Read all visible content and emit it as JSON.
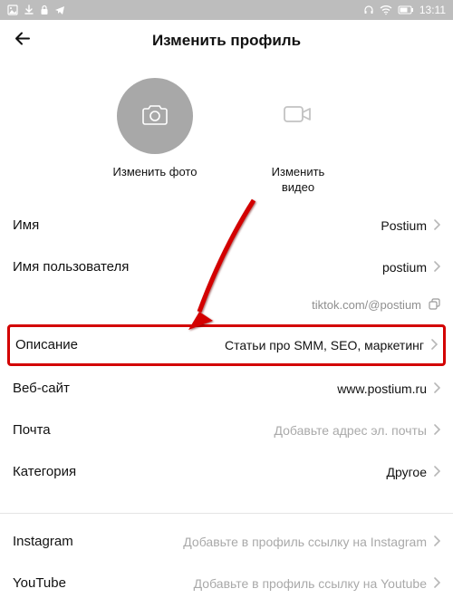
{
  "statusbar": {
    "time": "13:11"
  },
  "header": {
    "title": "Изменить профиль"
  },
  "media": {
    "photo_label": "Изменить фото",
    "video_label": "Изменить\nвидео"
  },
  "rows": {
    "name": {
      "label": "Имя",
      "value": "Postium"
    },
    "username": {
      "label": "Имя пользователя",
      "value": "postium"
    },
    "url": {
      "value": "tiktok.com/@postium"
    },
    "bio": {
      "label": "Описание",
      "value": "Статьи про SMM, SEO, маркетинг"
    },
    "website": {
      "label": "Веб-сайт",
      "value": "www.postium.ru"
    },
    "email": {
      "label": "Почта",
      "placeholder": "Добавьте адрес эл. почты"
    },
    "category": {
      "label": "Категория",
      "value": "Другое"
    },
    "instagram": {
      "label": "Instagram",
      "placeholder": "Добавьте в профиль ссылку на Instagram"
    },
    "youtube": {
      "label": "YouTube",
      "placeholder": "Добавьте в профиль ссылку на Youtube"
    }
  }
}
